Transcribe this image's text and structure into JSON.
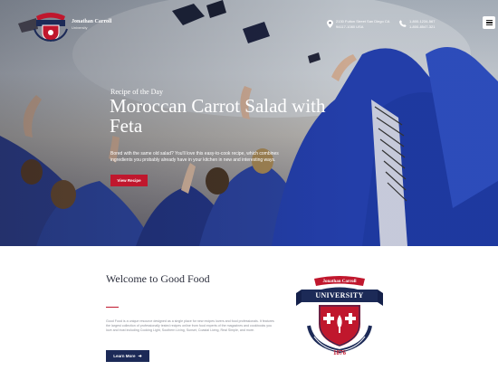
{
  "brand": {
    "name": "Jonathan Carroll",
    "subtitle": "University"
  },
  "header": {
    "address_line1": "2130 Fulton Street San Diego CA",
    "address_line2": "94117-1080 USA",
    "phone_line1": "1-800-1234-567",
    "phone_line2": "1-800-8547-321"
  },
  "hero": {
    "eyebrow": "Recipe of the Day",
    "title": "Moroccan Carrot Salad with Feta",
    "description": "Bored with the same old salad? You'll love this easy-to-cook recipe, which combines ingredients you probably already have in your kitchen in new and interesting ways.",
    "button_label": "View Recipe"
  },
  "welcome": {
    "title": "Welcome to Good Food",
    "text": "Good Food is a unique resource designed as a single place for new recipes lovers and food professionals. It features the largest collection of professionally tested recipes online from food experts of the magazines and cookbooks you love and trust including Cooking Light, Southern Living, Sunset, Coastal Living, Real Simple, and more.",
    "button_label": "Learn More"
  },
  "emblem": {
    "top_ribbon": "Jonathan Carroll",
    "banner": "UNIVERSITY",
    "year": "1876"
  },
  "colors": {
    "accent_red": "#c0172d",
    "navy": "#1c2a57",
    "heading": "#2c2f3d"
  },
  "icons": [
    "location-pin-icon",
    "phone-icon",
    "menu-icon",
    "arrow-right-icon"
  ]
}
